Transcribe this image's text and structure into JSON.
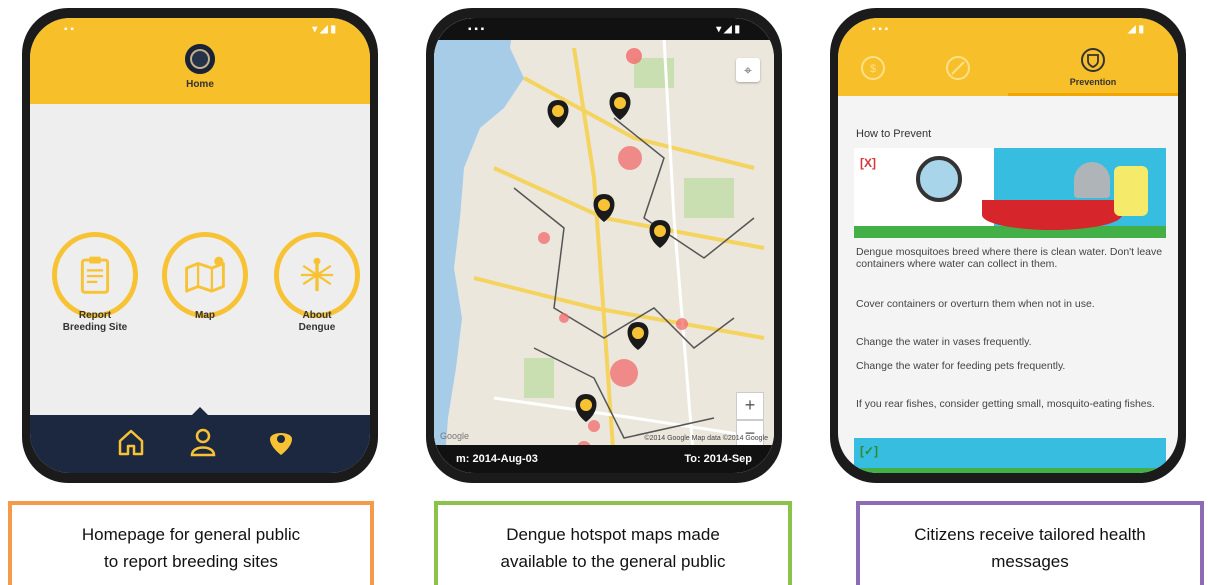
{
  "phone_home": {
    "title": "Home",
    "buttons": [
      {
        "line1": "Report",
        "line2": "Breeding Site"
      },
      {
        "line1": "Map",
        "line2": ""
      },
      {
        "line1": "About",
        "line2": "Dengue"
      }
    ],
    "nav_icons": [
      "home-icon",
      "person-icon",
      "dengue-alert-icon"
    ],
    "header_color": "#f7bf2a",
    "nav_color": "#1c2740"
  },
  "phone_map": {
    "from_label": "m: 2014-Aug-03",
    "to_label": "To: 2014-Sep",
    "zoom_in": "+",
    "zoom_out": "−",
    "google": "Google",
    "attribution": "©2014 Google   Map data ©2014 Google"
  },
  "phone_prevention": {
    "tabs": [
      "",
      "",
      "Prevention"
    ],
    "section_title": "How to Prevent",
    "tips": [
      "Dengue mosquitoes breed where there is clean water. Don't leave containers where water can collect in them.",
      "Cover containers or overturn them when not in use.",
      "Change the water in vases frequently.",
      "Change the water for feeding pets frequently.",
      "If you rear fishes, consider getting small, mosquito-eating fishes."
    ],
    "wrong_mark": "[X]",
    "right_mark": "[✓]"
  },
  "captions": [
    {
      "line1": "Homepage for general public",
      "line2": "to report breeding sites",
      "color": "#f39b4a"
    },
    {
      "line1": "Dengue hotspot maps made",
      "line2": "available to the general public",
      "color": "#8bc34a"
    },
    {
      "line1": "Citizens receive tailored health",
      "line2": "messages",
      "color": "#8e6bb5"
    }
  ]
}
